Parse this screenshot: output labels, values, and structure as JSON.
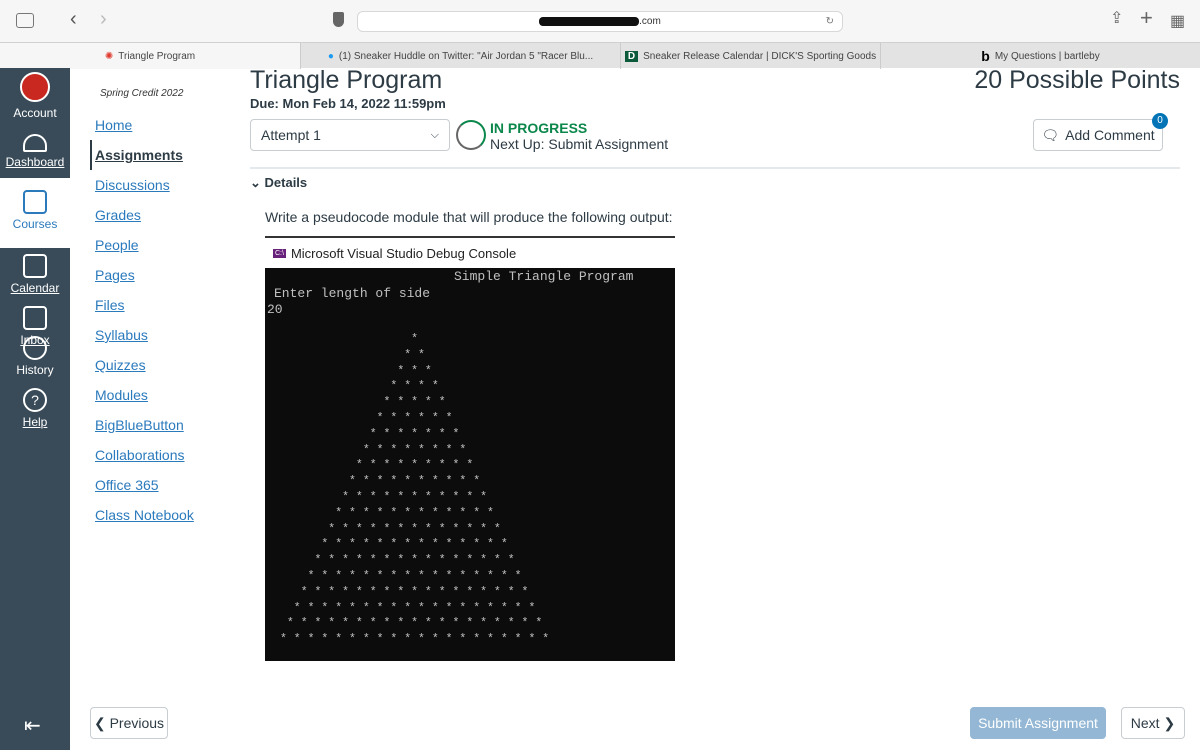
{
  "browser": {
    "url_visible": ".com",
    "tabs": [
      {
        "label": "Triangle Program",
        "icon": "canvas-icon",
        "active": true
      },
      {
        "label": "(1) Sneaker Huddle on Twitter: \"Air Jordan 5 \"Racer Blu...",
        "icon": "twitter-icon"
      },
      {
        "label": "Sneaker Release Calendar | DICK'S Sporting Goods",
        "icon": "dicks-icon"
      },
      {
        "label": "My Questions | bartleby",
        "icon": "bartleby-icon"
      }
    ]
  },
  "global_nav": [
    {
      "label": "Account",
      "icon": "avatar"
    },
    {
      "label": "Dashboard",
      "icon": "dashboard-icon"
    },
    {
      "label": "Courses",
      "icon": "courses-icon",
      "active": true
    },
    {
      "label": "Calendar",
      "icon": "calendar-icon"
    },
    {
      "label": "Inbox",
      "icon": "inbox-icon"
    },
    {
      "label": "History",
      "icon": "history-icon"
    },
    {
      "label": "Help",
      "icon": "help-icon"
    }
  ],
  "course_nav": {
    "term": "Spring Credit 2022",
    "items": [
      "Home",
      "Assignments",
      "Discussions",
      "Grades",
      "People",
      "Pages",
      "Files",
      "Syllabus",
      "Quizzes",
      "Modules",
      "BigBlueButton",
      "Collaborations",
      "Office 365",
      "Class Notebook"
    ],
    "active": "Assignments"
  },
  "assignment": {
    "title": "Triangle Program",
    "due": "Due: Mon Feb 14, 2022 11:59pm",
    "points": "20 Possible Points",
    "attempt": "Attempt 1",
    "status": "IN PROGRESS",
    "next_up": "Next Up: Submit Assignment",
    "add_comment": "Add Comment",
    "comment_count": "0",
    "details_label": "Details",
    "prompt": "Write a pseudocode module that will produce the following output:"
  },
  "console": {
    "window_title": "Microsoft Visual Studio Debug Console",
    "heading": "Simple Triangle Program",
    "prompt": "Enter length of side",
    "input": "20",
    "rows": 20,
    "symbol": "*"
  },
  "footer": {
    "previous": "Previous",
    "submit": "Submit Assignment",
    "next": "Next"
  },
  "colors": {
    "nav_bg": "#394b58",
    "link": "#2b7abc",
    "status_green": "#0b874b",
    "submit_bg": "#93b7d4"
  }
}
